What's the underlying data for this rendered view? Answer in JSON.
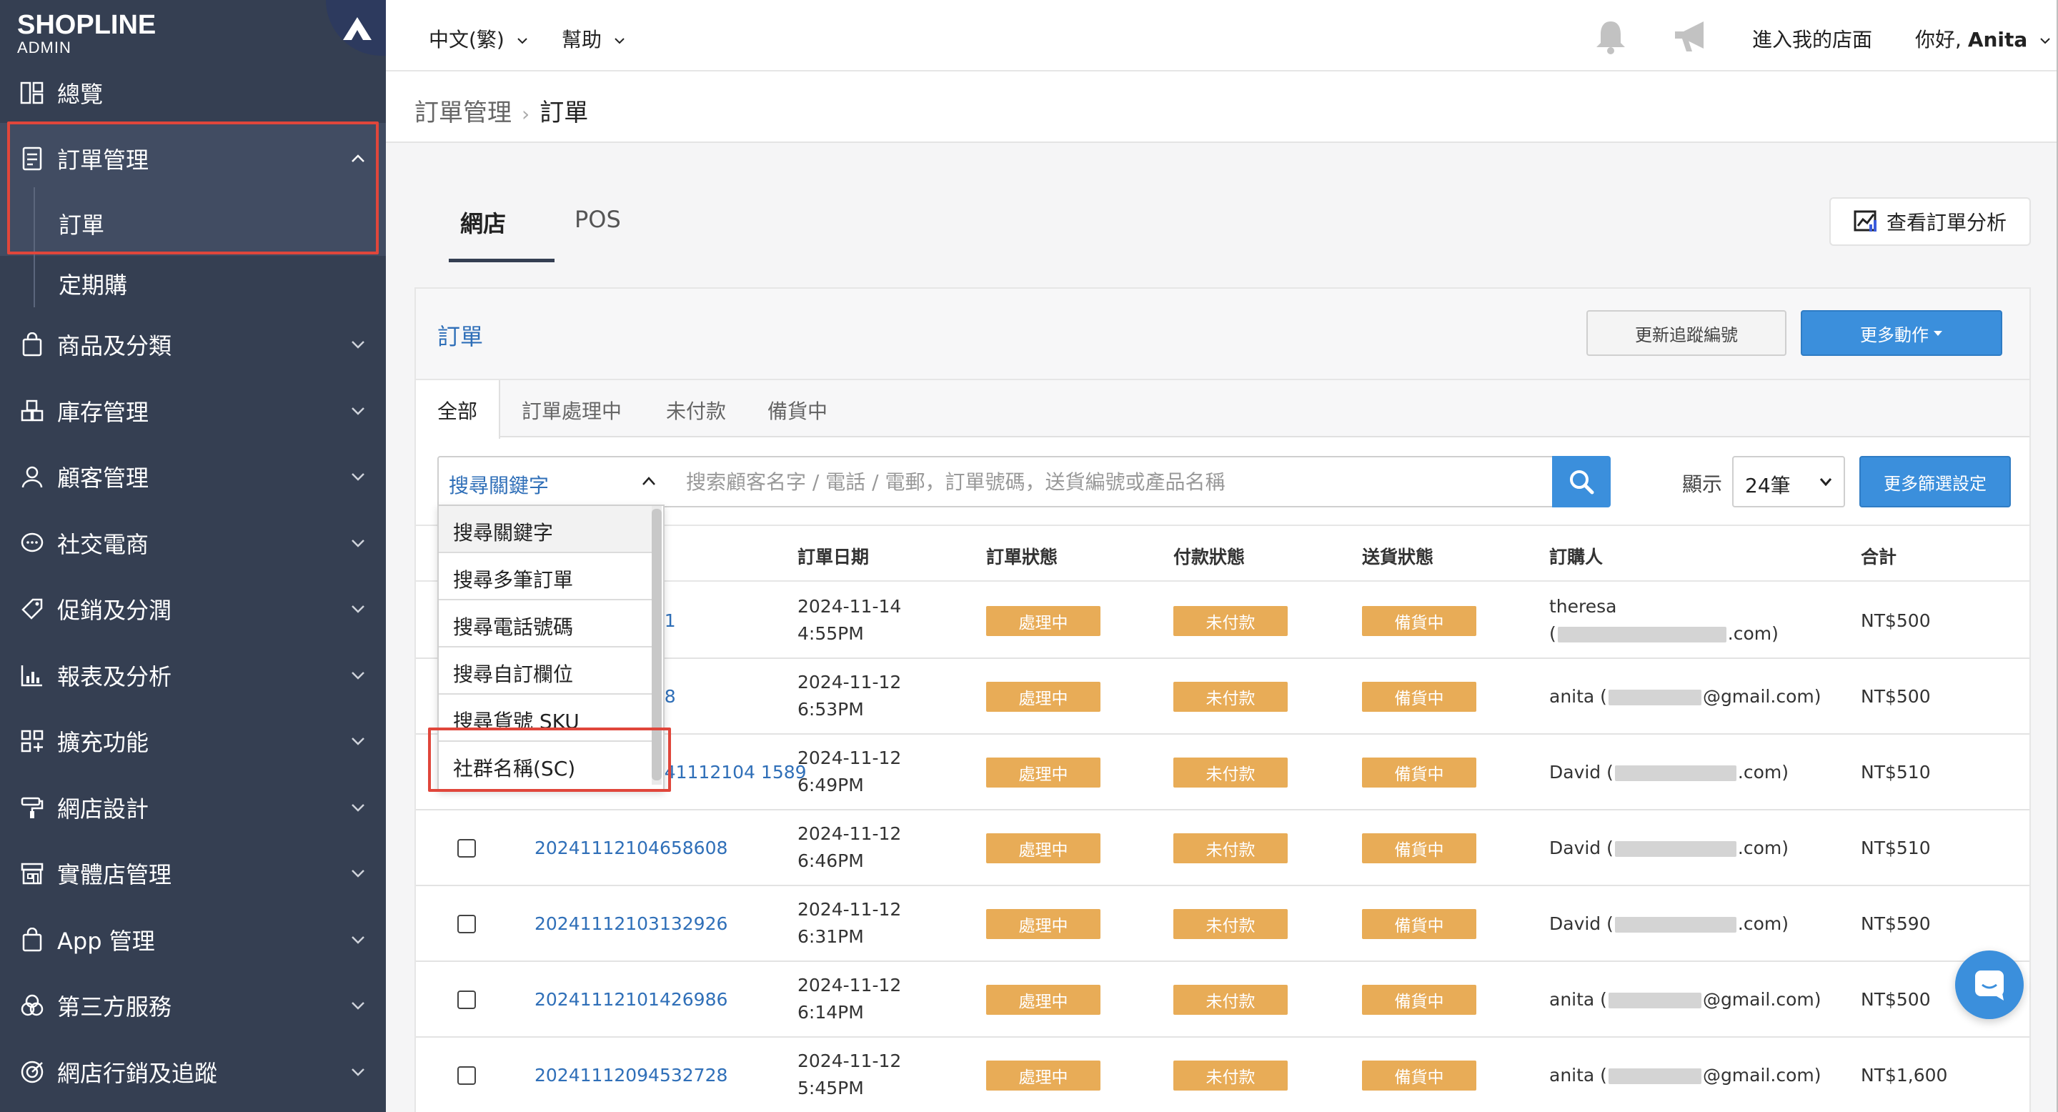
{
  "brand": {
    "logo": "SHOPLINE",
    "sub": "ADMIN"
  },
  "sidebar": {
    "items": [
      {
        "label": "總覽",
        "icon": "dashboard-icon"
      },
      {
        "label": "訂單管理",
        "icon": "order-icon"
      },
      {
        "label": "訂單",
        "icon": ""
      },
      {
        "label": "定期購",
        "icon": ""
      },
      {
        "label": "商品及分類",
        "icon": "bag-icon"
      },
      {
        "label": "庫存管理",
        "icon": "inventory-icon"
      },
      {
        "label": "顧客管理",
        "icon": "user-icon"
      },
      {
        "label": "社交電商",
        "icon": "chat-bubble-icon"
      },
      {
        "label": "促銷及分潤",
        "icon": "tag-icon"
      },
      {
        "label": "報表及分析",
        "icon": "report-icon"
      },
      {
        "label": "擴充功能",
        "icon": "grid-plus-icon"
      },
      {
        "label": "網店設計",
        "icon": "paint-roller-icon"
      },
      {
        "label": "實體店管理",
        "icon": "store-icon"
      },
      {
        "label": "App 管理",
        "icon": "bag-icon"
      },
      {
        "label": "第三方服務",
        "icon": "circles-icon"
      },
      {
        "label": "網店行銷及追蹤",
        "icon": "target-icon"
      }
    ]
  },
  "topbar": {
    "language": "中文(繁)",
    "help": "幫助",
    "visit_store": "進入我的店面",
    "greeting_prefix": "你好,",
    "user_name": "Anita"
  },
  "breadcrumb": {
    "parent": "訂單管理",
    "current": "訂單"
  },
  "tabs": {
    "webstore": "網店",
    "pos": "POS"
  },
  "analysis_button": "查看訂單分析",
  "card": {
    "title": "訂單",
    "update_tracking": "更新追蹤編號",
    "more_actions": "更多動作",
    "status_tabs": [
      "全部",
      "訂單處理中",
      "未付款",
      "備貨中"
    ]
  },
  "search": {
    "type_selected": "搜尋關鍵字",
    "placeholder": "搜索顧客名字 / 電話 / 電郵，訂單號碼，送貨編號或產品名稱",
    "show_label": "顯示",
    "per_page": "24筆",
    "more_filters": "更多篩選設定",
    "dropdown_options": [
      "搜尋關鍵字",
      "搜尋多筆訂單",
      "搜尋電話號碼",
      "搜尋自訂欄位",
      "搜尋貨號 SKU",
      "社群名稱(SC)"
    ]
  },
  "table": {
    "headers": {
      "date": "訂單日期",
      "order_status": "訂單狀態",
      "payment_status": "付款狀態",
      "delivery_status": "送貨狀態",
      "customer": "訂購人",
      "total": "合計"
    },
    "rows": [
      {
        "order_no": "9571",
        "date": "2024-11-14",
        "time": "4:55PM",
        "order_status": "處理中",
        "payment_status": "未付款",
        "delivery_status": "備貨中",
        "customer_name": "theresa",
        "customer_pre": "(",
        "customer_email_end": ".com)",
        "total": "NT$500"
      },
      {
        "order_no": "5288",
        "date": "2024-11-12",
        "time": "6:53PM",
        "order_status": "處理中",
        "payment_status": "未付款",
        "delivery_status": "備貨中",
        "customer_name": "anita (",
        "customer_pre": "",
        "customer_email_end": "@gmail.com)",
        "total": "NT$500"
      },
      {
        "order_no": "20241112104 1589",
        "date": "2024-11-12",
        "time": "6:49PM",
        "order_status": "處理中",
        "payment_status": "未付款",
        "delivery_status": "備貨中",
        "customer_name": "David (",
        "customer_pre": "",
        "customer_email_end": ".com)",
        "total": "NT$510"
      },
      {
        "order_no": "20241112104658608",
        "date": "2024-11-12",
        "time": "6:46PM",
        "order_status": "處理中",
        "payment_status": "未付款",
        "delivery_status": "備貨中",
        "customer_name": "David (",
        "customer_pre": "",
        "customer_email_end": ".com)",
        "total": "NT$510"
      },
      {
        "order_no": "20241112103132926",
        "date": "2024-11-12",
        "time": "6:31PM",
        "order_status": "處理中",
        "payment_status": "未付款",
        "delivery_status": "備貨中",
        "customer_name": "David (",
        "customer_pre": "",
        "customer_email_end": ".com)",
        "total": "NT$590"
      },
      {
        "order_no": "20241112101426986",
        "date": "2024-11-12",
        "time": "6:14PM",
        "order_status": "處理中",
        "payment_status": "未付款",
        "delivery_status": "備貨中",
        "customer_name": "anita (",
        "customer_pre": "",
        "customer_email_end": "@gmail.com)",
        "total": "NT$500"
      },
      {
        "order_no": "20241112094532728",
        "date": "2024-11-12",
        "time": "5:45PM",
        "order_status": "處理中",
        "payment_status": "未付款",
        "delivery_status": "備貨中",
        "customer_name": "anita (",
        "customer_pre": "",
        "customer_email_end": "@gmail.com)",
        "total": "NT$1,600"
      }
    ]
  },
  "colors": {
    "sidebar_bg": "#353f52",
    "accent_blue": "#3b8fdc",
    "badge_orange": "#e8ac57",
    "highlight_red": "#e0463b",
    "link_blue": "#2f6fb8"
  }
}
